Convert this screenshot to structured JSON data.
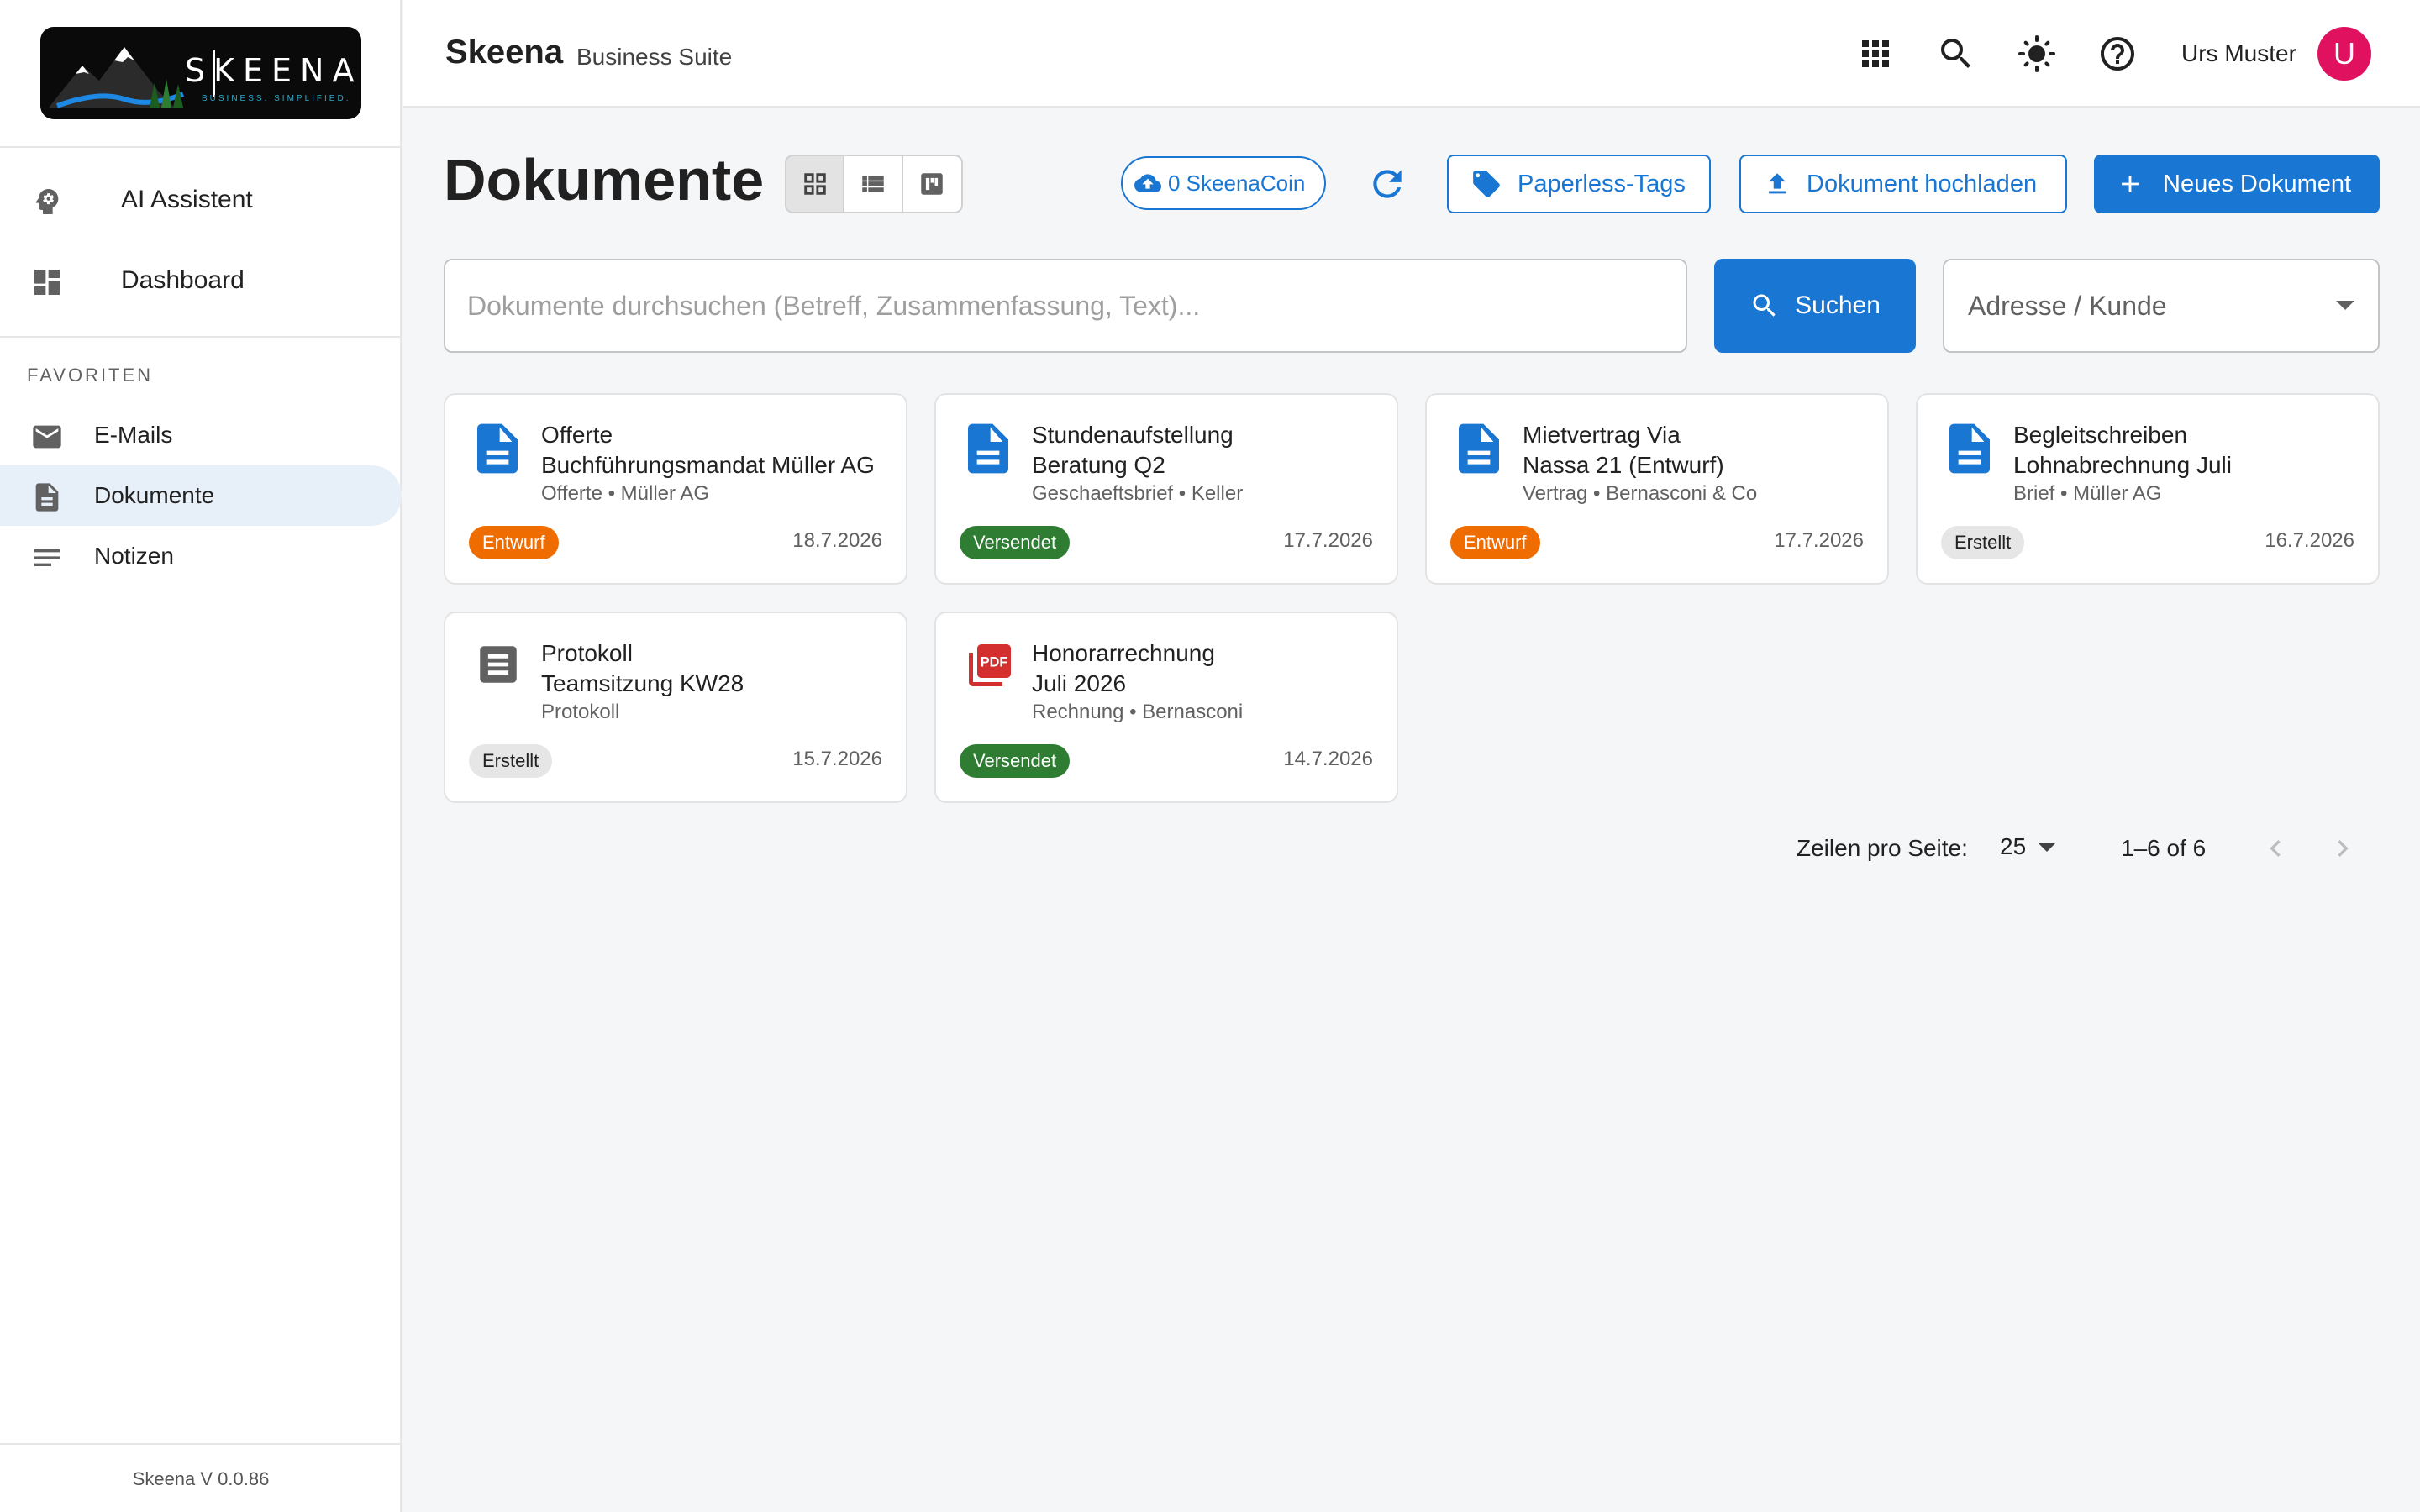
{
  "sidebar": {
    "logo_text": "SKEENA",
    "logo_tagline": "BUSINESS. SIMPLIFIED.",
    "top_items": [
      {
        "label": "AI Assistent",
        "icon": "ai-head-icon"
      },
      {
        "label": "Dashboard",
        "icon": "dashboard-icon"
      }
    ],
    "favorites_heading": "FAVORITEN",
    "favorites": [
      {
        "label": "E-Mails",
        "icon": "mail-icon"
      },
      {
        "label": "Dokumente",
        "icon": "document-icon",
        "active": true
      },
      {
        "label": "Notizen",
        "icon": "notes-icon"
      }
    ],
    "version": "Skeena V 0.0.86"
  },
  "header": {
    "brand": "Skeena",
    "brand_sub": "Business Suite",
    "user_name": "Urs Muster",
    "avatar_initial": "U",
    "avatar_color": "#e0115f"
  },
  "main": {
    "title": "Dokumente",
    "coin_label": "0 SkeenaCoin",
    "tags_button": "Paperless-Tags",
    "upload_button": "Dokument hochladen",
    "new_button": "Neues Dokument",
    "search": {
      "placeholder": "Dokumente durchsuchen (Betreff, Zusammenfassung, Text)...",
      "value": "",
      "button": "Suchen"
    },
    "filter_select": "Adresse / Kunde",
    "accent": "#1976d2",
    "cards": [
      {
        "title1": "Offerte",
        "title2": "Buchführungsmandat Müller AG",
        "meta": "Offerte • Müller AG",
        "status": "Entwurf",
        "status_kind": "entwurf",
        "date": "18.7.2026",
        "icon": "blue-document-icon"
      },
      {
        "title1": "Stundenaufstellung",
        "title2": "Beratung Q2",
        "meta": "Geschaeftsbrief • Keller",
        "status": "Versendet",
        "status_kind": "versendet",
        "date": "17.7.2026",
        "icon": "blue-document-icon"
      },
      {
        "title1": "Mietvertrag Via",
        "title2": "Nassa 21 (Entwurf)",
        "meta": "Vertrag • Bernasconi & Co",
        "status": "Entwurf",
        "status_kind": "entwurf",
        "date": "17.7.2026",
        "icon": "blue-document-icon"
      },
      {
        "title1": "Begleitschreiben",
        "title2": "Lohnabrechnung Juli",
        "meta": "Brief • Müller AG",
        "status": "Erstellt",
        "status_kind": "erstellt",
        "date": "16.7.2026",
        "icon": "blue-document-icon"
      },
      {
        "title1": "Protokoll",
        "title2": "Teamsitzung KW28",
        "meta": "Protokoll",
        "status": "Erstellt",
        "status_kind": "erstellt",
        "date": "15.7.2026",
        "icon": "grey-note-icon"
      },
      {
        "title1": "Honorarrechnung",
        "title2": "Juli 2026",
        "meta": "Rechnung • Bernasconi",
        "status": "Versendet",
        "status_kind": "versendet",
        "date": "14.7.2026",
        "icon": "pdf-icon"
      }
    ],
    "pagination": {
      "rows_label": "Zeilen pro Seite:",
      "rows_value": "25",
      "range": "1–6 of 6"
    }
  }
}
